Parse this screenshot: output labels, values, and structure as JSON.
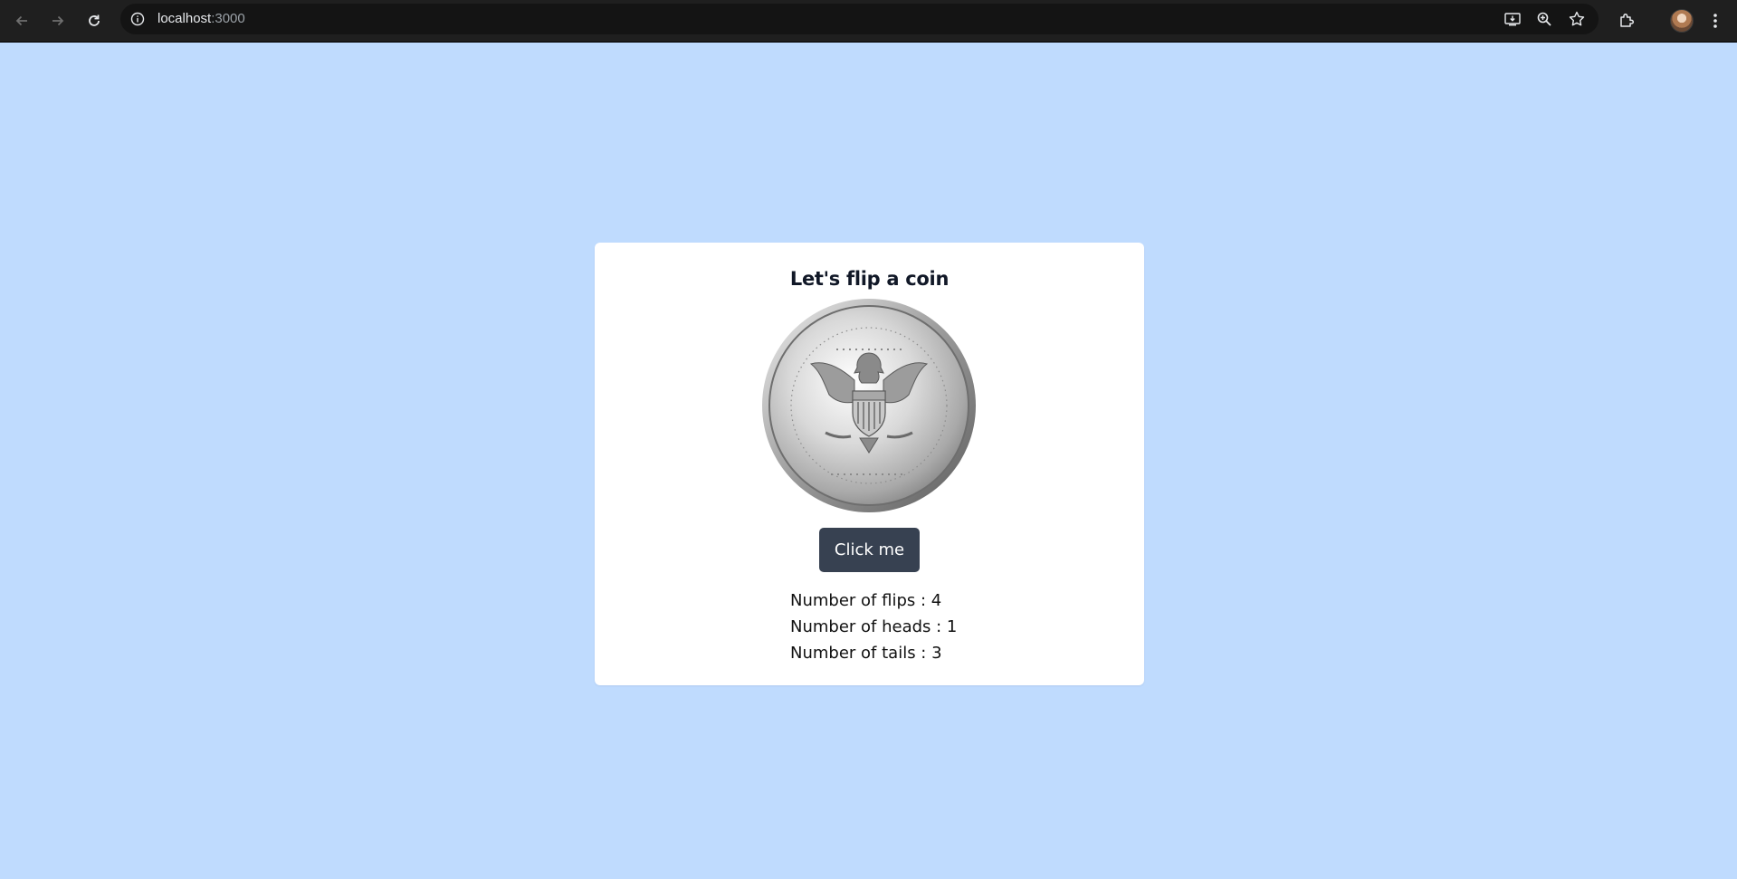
{
  "browser": {
    "url_host": "localhost",
    "url_port": ":3000",
    "icons": [
      "back-arrow-icon",
      "forward-arrow-icon",
      "reload-icon",
      "site-info-icon",
      "install-app-icon",
      "zoom-icon",
      "bookmark-star-icon",
      "extensions-icon",
      "profile-avatar",
      "more-menu-icon"
    ]
  },
  "colors": {
    "page_background": "#bfdbfe",
    "card_background": "#ffffff",
    "button_background": "#374151",
    "button_text": "#ffffff",
    "title_text": "#111827"
  },
  "card": {
    "title": "Let's flip a coin",
    "coin_image": "coin-half-dollar-eagle",
    "button_label": "Click me",
    "stats": {
      "flips": "Number of flips : 4",
      "heads": "Number of heads : 1",
      "tails": "Number of tails : 3"
    }
  }
}
